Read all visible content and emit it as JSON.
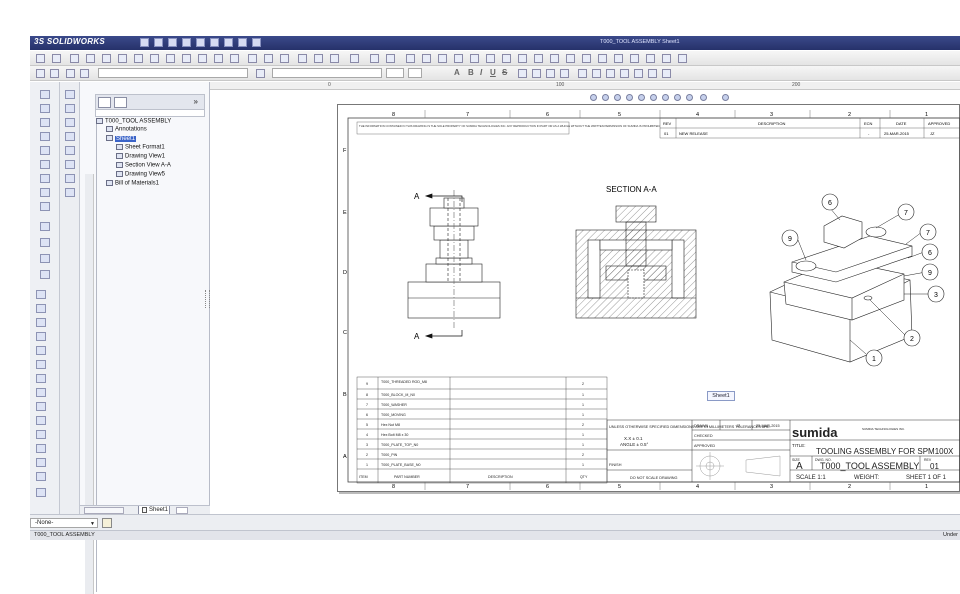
{
  "app": {
    "logo": "SOLIDWORKS",
    "logo_prefix": "3S",
    "window_title": "T000_TOOL ASSEMBLY  Sheet1"
  },
  "feature_manager": {
    "root": "T000_TOOL ASSEMBLY",
    "items": [
      {
        "label": "Annotations"
      },
      {
        "label": "Sheet1",
        "selected": true
      },
      {
        "label": "Sheet Format1"
      },
      {
        "label": "Drawing View1"
      },
      {
        "label": "Section View A-A"
      },
      {
        "label": "Drawing View5"
      },
      {
        "label": "Bill of Materials1"
      }
    ],
    "collapse": "»"
  },
  "ruler": {
    "marks": [
      "0",
      "100",
      "200"
    ]
  },
  "drawing": {
    "top_zones": [
      "8",
      "7",
      "6",
      "5",
      "4",
      "3",
      "2",
      "1"
    ],
    "bottom_zones": [
      "8",
      "7",
      "6",
      "5",
      "4",
      "3",
      "2",
      "1"
    ],
    "side_zones": [
      "F",
      "E",
      "D",
      "C",
      "B",
      "A"
    ],
    "section_title": "SECTION A-A",
    "section_letter": "A",
    "notice": "THE INFORMATION CONTAINED IN THIS DRAWING IS THE SOLE PROPERTY OF SUMIDA TECHNOLOGIES INC. ANY REPRODUCTION IN PART OR AS A WHOLE WITHOUT THE WRITTEN PERMISSION OF SUMIDA IS PROHIBITED.",
    "revisions": {
      "headers": [
        "REV",
        "DESCRIPTION",
        "ECN",
        "DATE",
        "APPROVED"
      ],
      "row": [
        "01",
        "NEW RELEASE",
        "-",
        "25-MAR-2015",
        "JZ"
      ]
    },
    "bom": {
      "headers": [
        "ITEM",
        "PART NUMBER",
        "DESCRIPTION",
        "QTY"
      ],
      "rows": [
        [
          "9",
          "T000_THREADED ROD_M8",
          "",
          "2"
        ],
        [
          "8",
          "T000_BLOCK_M_N0",
          "",
          "1"
        ],
        [
          "7",
          "T000_WASHER",
          "",
          "1"
        ],
        [
          "6",
          "T000_MOVING",
          "",
          "1"
        ],
        [
          "5",
          "Hex Nut M8",
          "",
          "2"
        ],
        [
          "4",
          "Hex Bolt M8 x 30",
          "",
          "1"
        ],
        [
          "3",
          "T000_PLATE_TOP_N0",
          "",
          "1"
        ],
        [
          "2",
          "T000_PIN",
          "",
          "2"
        ],
        [
          "1",
          "T000_PLATE_BASE_N0",
          "",
          "1"
        ]
      ]
    },
    "balloons": [
      "6",
      "7",
      "7",
      "9",
      "6",
      "9",
      "3",
      "2",
      "1"
    ],
    "title_block": {
      "tolerance_note": "UNLESS OTHERWISE SPECIFIED DIMENSIONS ARE IN MILLIMETERS TOLERANCES ARE:",
      "tol_xx": "X.X ± 0.1",
      "tol_angle": "ANGLE ± 0.5°",
      "drawn_label": "DRAWN",
      "drawn_by": "JZ",
      "drawn_date": "25-MAR-2015",
      "checked_label": "CHECKED",
      "approved_label": "APPROVED",
      "finish_label": "FINISH",
      "no_scale": "DO NOT SCALE DRAWING",
      "company": "sumida",
      "company_address": "SUMIDA TECHNOLOGIES INC.",
      "title_label": "TITLE:",
      "title": "TOOLING ASSEMBLY FOR SPM100X",
      "size_label": "SIZE",
      "size": "A",
      "dwg_label": "DWG. NO.",
      "dwg_no": "T000_TOOL ASSEMBLY",
      "rev_label": "REV",
      "rev": "01",
      "scale": "SCALE 1:1",
      "weight": "WEIGHT:",
      "sheet": "SHEET 1 OF 1"
    }
  },
  "tooltip": "Sheet1",
  "bottom": {
    "sheet_tab": "Sheet1",
    "layer_select": "-None-"
  },
  "status": {
    "left": "T000_TOOL ASSEMBLY",
    "right": "Under"
  },
  "colors": {
    "title_bar": "#2f3b7c",
    "selection": "#3a63c8",
    "sheet_line": "#222222"
  }
}
